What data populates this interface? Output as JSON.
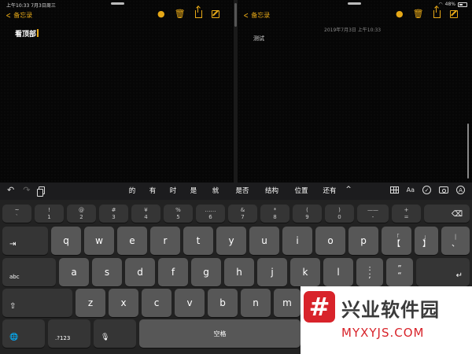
{
  "status_bar": {
    "time_date": "上午10:33  7月3日周三",
    "battery": "48%"
  },
  "left_pane": {
    "back_label": "备忘录",
    "note_title": "看顶部"
  },
  "right_pane": {
    "back_label": "备忘录",
    "note_date": "2019年7月3日 上午10:33",
    "note_body": "测试"
  },
  "shortcut_bar": {
    "undo_icon": "↶",
    "redo_icon": "↷",
    "suggestions": [
      "的",
      "有",
      "时",
      "是",
      "就",
      "是否",
      "结构",
      "位置",
      "还有"
    ],
    "expand_icon": "^",
    "format_label": "Aa"
  },
  "keyboard": {
    "row1": [
      {
        "top": "~",
        "bot": "`"
      },
      {
        "top": "!",
        "bot": "1"
      },
      {
        "top": "@",
        "bot": "2"
      },
      {
        "top": "#",
        "bot": "3"
      },
      {
        "top": "¥",
        "bot": "4"
      },
      {
        "top": "%",
        "bot": "5"
      },
      {
        "top": "……",
        "bot": "6"
      },
      {
        "top": "&",
        "bot": "7"
      },
      {
        "top": "*",
        "bot": "8"
      },
      {
        "top": "(",
        "bot": "9"
      },
      {
        "top": ")",
        "bot": "0"
      },
      {
        "top": "——",
        "bot": "-"
      },
      {
        "top": "+",
        "bot": "="
      }
    ],
    "row2": [
      "q",
      "w",
      "e",
      "r",
      "t",
      "y",
      "u",
      "i",
      "o",
      "p"
    ],
    "row2_extra": [
      {
        "top": "「",
        "bot": "【"
      },
      {
        "top": "」",
        "bot": "】"
      },
      {
        "top": "|",
        "bot": "、"
      }
    ],
    "row3": [
      "a",
      "s",
      "d",
      "f",
      "g",
      "h",
      "j",
      "k",
      "l"
    ],
    "row3_extra": [
      {
        "top": ":",
        "bot": ";"
      },
      {
        "top": "”",
        "bot": "“"
      }
    ],
    "row4": [
      "z",
      "x",
      "c",
      "v",
      "b",
      "n",
      "m"
    ],
    "delete_icon": "⌫",
    "tab_icon": "⇥",
    "caps_label": "abc",
    "return_icon": "↵",
    "shift_icon": "⇧",
    "globe_icon": "🌐",
    "numbers_label": ".?123",
    "mic_icon": "🎙",
    "space_label": "空格"
  },
  "watermark": {
    "badge": "#",
    "chinese": "兴业软件园",
    "english": "MYXYJS.COM"
  }
}
